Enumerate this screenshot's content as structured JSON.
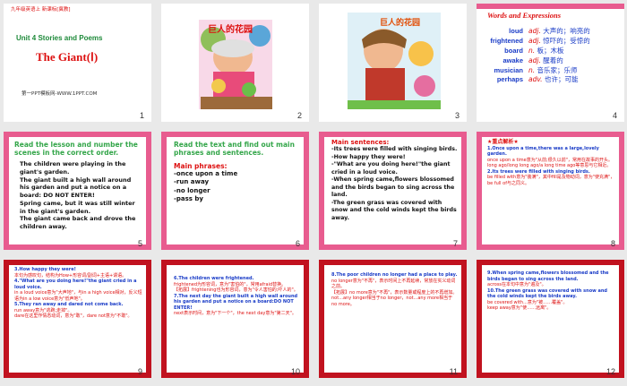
{
  "slides": [
    {
      "num": "1",
      "top_tag": "九年级英语上 新课标[冀教]",
      "unit": "Unit 4  Stories and Poems",
      "title": "The Giant(Ⅰ)",
      "footer": "第一PPT模板网-WWW.1PPT.COM"
    },
    {
      "num": "2",
      "book_title": "巨人的花园"
    },
    {
      "num": "3",
      "book_title": "巨人的花园"
    },
    {
      "num": "4",
      "heading": "Words and Expressions",
      "rows": [
        {
          "w": "loud",
          "pos": "adj.",
          "m": "大声的；响亮的"
        },
        {
          "w": "frightened",
          "pos": "adj.",
          "m": "惊吓的；受惊的"
        },
        {
          "w": "board",
          "pos": "n.",
          "m": "板；木板"
        },
        {
          "w": "awake",
          "pos": "adj.",
          "m": "醒着的"
        },
        {
          "w": "musician",
          "pos": "n.",
          "m": "音乐家；乐师"
        },
        {
          "w": "perhaps",
          "pos": "adv.",
          "m": "也许；可能"
        }
      ]
    },
    {
      "num": "5",
      "title": "Read the lesson and number the scenes in the correct order.",
      "items": [
        "The children were playing in the giant's garden.",
        "The giant built a high wall around his garden and put a notice on a board: DO NOT ENTER!",
        "Spring came, but it was still winter in the giant's garden.",
        "The giant came back and drove the children away."
      ]
    },
    {
      "num": "6",
      "title": "Read the text and find out main phrases and sentences.",
      "sub": "Main phrases:",
      "items": [
        "-once upon a time",
        "-run away",
        "-no longer",
        "-pass by"
      ]
    },
    {
      "num": "7",
      "sub": "Main sentences:",
      "items": [
        "-Its trees were filled with singing birds.",
        "-How happy they were!",
        "-\"What are you doing here!\"the giant cried in a loud voice.",
        "-When spring came,flowers blossomed and the birds began to sing across the land.",
        "-The green grass was covered with snow and the cold winds kept the birds away."
      ]
    },
    {
      "num": "8",
      "title": "★重点解析★",
      "lines": [
        "1.Once upon a time,there was a large,lovely garden.",
        "once upon a time意为\"从前;很久以前\"，常用在故事的开头。",
        "long ago/long long ago/a long time ago等意思与它相近。",
        "2.Its trees were filled with singing birds.",
        "be filled with意为\"装满\"，其中fill是及物动词，意为\"使充满\"，be full of与之同义。"
      ]
    },
    {
      "num": "9",
      "lines": [
        "3.How happy they were!",
        "本句为感叹句，结构为How+形容词/副词+主语+谓语。",
        "4.\"What are you doing here!\"the giant cried in a loud voice.",
        "in a loud voice意为\"大声地\"，与in a high voice相对，反义短语为in a low voice意为\"低声地\"。",
        "5.They ran away and dared not come back.",
        "run away意为\"逃跑;走掉\"。",
        "dare在这里作情态动词，意为\"敢\"，dare not意为\"不敢\"。"
      ]
    },
    {
      "num": "10",
      "lines": [
        "6.The children were frightened.",
        "frightened为形容词，意为\"害怕的\"，常用afraid替换。",
        "【拓展】frightening也为形容词，意为\"令人害怕的;吓人的\"。",
        "7.The next day the giant built a high wall around his garden and put a notice on a board:DO NOT ENTER!",
        "next表示时间，意为\"下一个\"，the next day意为\"第二天\"。"
      ]
    },
    {
      "num": "11",
      "lines": [
        "8.The poor children no longer had a place to play.",
        "no longer意为\"不再\"，表示时间上不再延续，常放在实义动词之前。",
        "【拓展】no more意为\"不再\"，表示数量或程度上的不再增加。",
        "not...any longer相当于no longer，not...any more相当于no more。"
      ]
    },
    {
      "num": "12",
      "lines": [
        "9.When spring came,flowers blossomed and the birds began to sing across the land.",
        "across在本句中意为\"遍及\"。",
        "10.The green grass was covered with snow and the cold winds kept the birds away.",
        "be covered with...意为\"被……覆盖\"。",
        "keep away意为\"使……远离\"。"
      ]
    }
  ]
}
